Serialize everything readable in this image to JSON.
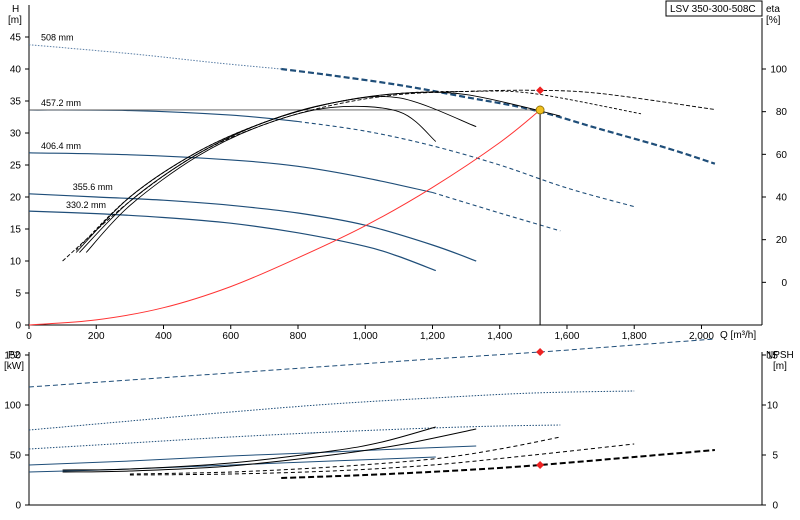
{
  "title": "LSV 350-300-508C",
  "colors": {
    "pump": "#1f4e79",
    "pump_light": "#5b7fa6",
    "eta": "#000000",
    "system": "#ff3333",
    "duty_point": "#f0c020",
    "marker": "#ee2222"
  },
  "chart_data": [
    {
      "type": "line",
      "title": "",
      "xlabel": "Q [m³/h]",
      "ylabel": "H [m]",
      "y2label": "eta [%]",
      "xlim": [
        0,
        2180
      ],
      "ylim": [
        0,
        50
      ],
      "y2lim": [
        -20,
        130
      ],
      "xticks": [
        0,
        200,
        400,
        600,
        800,
        1000,
        1200,
        1400,
        1600,
        1800,
        2000
      ],
      "xtick_labels": [
        "0",
        "200",
        "400",
        "600",
        "800",
        "1,000",
        "1,200",
        "1,400",
        "1,600",
        "1,800",
        "2,000"
      ],
      "yticks": [
        0,
        5,
        10,
        15,
        20,
        25,
        30,
        35,
        40,
        45
      ],
      "y2ticks": [
        0,
        20,
        40,
        60,
        80,
        100
      ],
      "head_curves": [
        {
          "name": "508 mm",
          "x": [
            0,
            300,
            550,
            750,
            900,
            1100,
            1300,
            1500,
            1700,
            1900,
            2040
          ],
          "y": [
            43.8,
            42.4,
            41.0,
            40.0,
            39.0,
            37.5,
            35.6,
            33.6,
            30.6,
            27.6,
            25.2
          ],
          "bold_from": 750
        },
        {
          "name": "457.2 mm",
          "x": [
            0,
            300,
            600,
            800,
            1000,
            1200,
            1400,
            1600,
            1800
          ],
          "y": [
            33.6,
            33.5,
            32.8,
            31.8,
            30.3,
            28.0,
            25.0,
            21.4,
            18.5
          ],
          "bold_until": 760
        },
        {
          "name": "406.4 mm",
          "x": [
            0,
            300,
            600,
            800,
            1000,
            1200,
            1400,
            1580
          ],
          "y": [
            26.9,
            26.6,
            25.8,
            24.8,
            23.0,
            20.7,
            17.5,
            14.7
          ],
          "bold_until": 1050
        },
        {
          "name": "355.6 mm",
          "x": [
            0,
            200,
            400,
            600,
            800,
            1000,
            1200,
            1330
          ],
          "y": [
            20.5,
            20.0,
            19.5,
            18.7,
            17.5,
            15.6,
            12.5,
            10.0
          ]
        },
        {
          "name": "330.2 mm",
          "x": [
            0,
            200,
            400,
            600,
            800,
            1000,
            1100,
            1210
          ],
          "y": [
            17.8,
            17.4,
            16.8,
            15.9,
            14.4,
            12.3,
            10.7,
            8.5
          ]
        }
      ],
      "efficiency_curves": [
        {
          "x": [
            100,
            300,
            500,
            700,
            900,
            1100,
            1300,
            1500,
            1700,
            2040
          ],
          "y": [
            10,
            38,
            60,
            74,
            83,
            88,
            89.5,
            90,
            88.5,
            81
          ]
        },
        {
          "x": [
            140,
            300,
            500,
            700,
            900,
            1100,
            1300,
            1500,
            1820
          ],
          "y": [
            15,
            40,
            61,
            75,
            84,
            88.5,
            89.5,
            88.5,
            79
          ]
        },
        {
          "x": [
            140,
            300,
            500,
            700,
            900,
            1100,
            1300,
            1580
          ],
          "y": [
            14,
            40,
            61,
            75,
            84,
            88.5,
            88,
            78
          ]
        },
        {
          "x": [
            150,
            300,
            500,
            700,
            900,
            1100,
            1330
          ],
          "y": [
            14,
            38,
            60,
            75,
            84,
            86.5,
            73
          ]
        },
        {
          "x": [
            170,
            300,
            500,
            700,
            900,
            1100,
            1210
          ],
          "y": [
            14,
            36,
            59,
            74,
            82,
            80,
            66
          ]
        }
      ],
      "system_curve": {
        "x": [
          0,
          200,
          400,
          600,
          800,
          1000,
          1200,
          1400,
          1520
        ],
        "y": [
          0,
          0.8,
          2.7,
          6.0,
          10.5,
          15.5,
          21.5,
          28.5,
          33.6
        ]
      },
      "duty_point": {
        "q": 1520,
        "h": 33.6
      },
      "eta_point": {
        "q": 1520,
        "eta": 90
      }
    },
    {
      "type": "line",
      "ylabel": "P2 [kW]",
      "y2label": "NPSH [m]",
      "ylim": [
        0,
        185
      ],
      "y2lim": [
        0,
        18.5
      ],
      "yticks": [
        0,
        50,
        100,
        150
      ],
      "y2ticks": [
        0,
        5,
        10,
        15
      ],
      "power_curves": [
        {
          "name": "508 mm",
          "x": [
            0,
            300,
            600,
            900,
            1200,
            1520,
            1800,
            2040
          ],
          "y": [
            118,
            125,
            132,
            139,
            146,
            153,
            160,
            166
          ],
          "style": "dashed"
        },
        {
          "name": "457.2 mm",
          "x": [
            0,
            300,
            600,
            900,
            1200,
            1500,
            1800
          ],
          "y": [
            75,
            84,
            93,
            101,
            107,
            112,
            114
          ],
          "style": "dotted"
        },
        {
          "name": "406.4 mm",
          "x": [
            0,
            300,
            600,
            900,
            1200,
            1400,
            1580
          ],
          "y": [
            56,
            62,
            68,
            73,
            77,
            79,
            80
          ],
          "style": "dotted"
        },
        {
          "name": "355.6 mm",
          "x": [
            0,
            300,
            600,
            900,
            1100,
            1330
          ],
          "y": [
            40,
            44,
            49,
            53,
            56,
            59
          ],
          "style": "solid"
        },
        {
          "name": "330.2 mm",
          "x": [
            0,
            300,
            600,
            900,
            1210
          ],
          "y": [
            33,
            36,
            40,
            44,
            48
          ],
          "style": "solid"
        }
      ],
      "npsh_curves": [
        {
          "name": "508 mm",
          "x": [
            750,
            1000,
            1300,
            1520,
            1800,
            2040
          ],
          "y": [
            2.7,
            3.0,
            3.5,
            4.0,
            4.8,
            5.5
          ],
          "style": "dashed-bold"
        },
        {
          "name": "457.2 mm",
          "x": [
            300,
            600,
            900,
            1200,
            1500,
            1800
          ],
          "y": [
            3.0,
            3.1,
            3.4,
            4.0,
            5.0,
            6.1
          ],
          "style": "dashed"
        },
        {
          "name": "406.4 mm",
          "x": [
            300,
            600,
            900,
            1200,
            1400,
            1580
          ],
          "y": [
            3.1,
            3.3,
            3.8,
            4.6,
            5.6,
            6.8
          ],
          "style": "dashed"
        },
        {
          "name": "355.6 mm",
          "x": [
            100,
            300,
            600,
            900,
            1100,
            1330
          ],
          "y": [
            3.3,
            3.4,
            3.9,
            5.0,
            6.0,
            7.6
          ],
          "style": "solid"
        },
        {
          "name": "330.2 mm",
          "x": [
            100,
            300,
            600,
            900,
            1050,
            1210
          ],
          "y": [
            3.5,
            3.6,
            4.2,
            5.4,
            6.3,
            7.8
          ],
          "style": "solid"
        }
      ],
      "power_point": {
        "q": 1520,
        "p": 153
      },
      "npsh_point": {
        "q": 1520,
        "npsh": 4.0
      }
    }
  ]
}
